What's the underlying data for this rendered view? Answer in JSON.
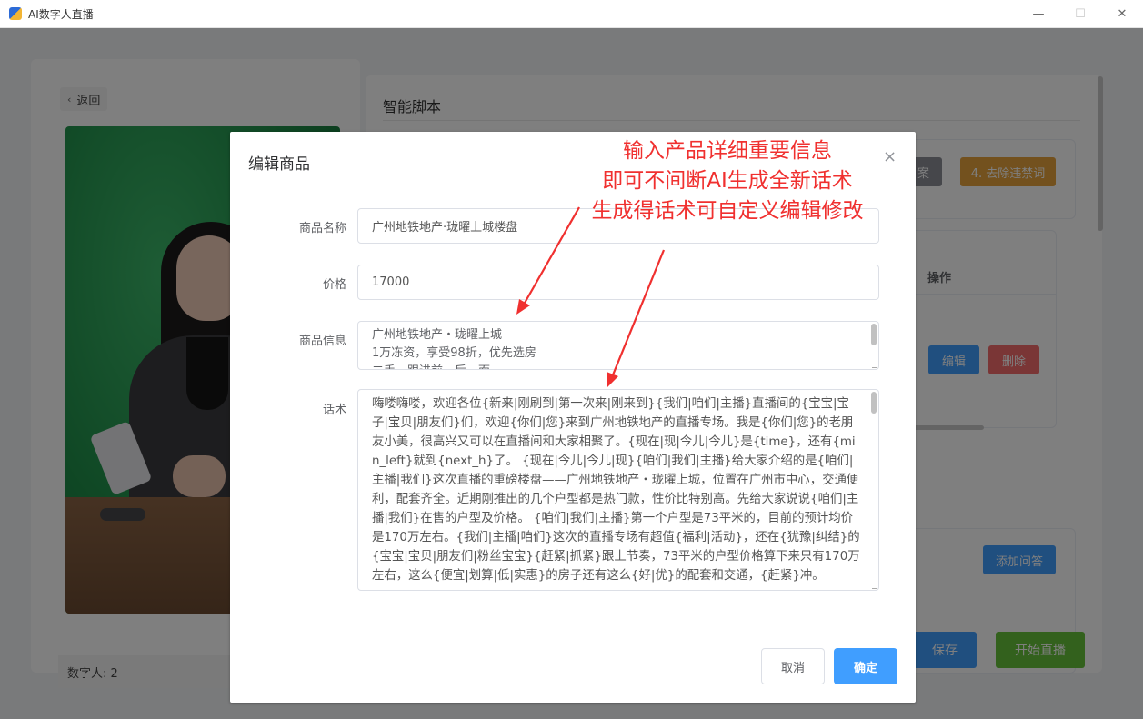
{
  "window": {
    "title": "AI数字人直播",
    "minimize_glyph": "—",
    "maximize_glyph": "☐",
    "close_glyph": "✕"
  },
  "left_panel": {
    "back_label": "返回",
    "digital_human_label": "数字人: 2"
  },
  "right_panel": {
    "title": "智能脚本",
    "buttons": {
      "partial_label": "案",
      "remove_banned_words": "4. 去除违禁词",
      "edit": "编辑",
      "delete": "删除",
      "add_qa": "添加问答",
      "save": "保存",
      "start_live": "开始直播"
    },
    "table_header_operation": "操作"
  },
  "dialog": {
    "title": "编辑商品",
    "close_glyph": "×",
    "fields": {
      "name_label": "商品名称",
      "name_value": "广州地铁地产·珑曜上城楼盘",
      "price_label": "价格",
      "price_value": "17000",
      "info_label": "商品信息",
      "info_lines": [
        "广州地铁地产・珑曜上城",
        "1万冻资，享受98折，优先选房",
        "二手…跟进前…后…面"
      ],
      "script_label": "话术",
      "script_value": "嗨喽嗨喽，欢迎各位{新来|刚刷到|第一次来|刚来到}{我们|咱们|主播}直播间的{宝宝|宝子|宝贝|朋友们}们，欢迎{你们|您}来到广州地铁地产的直播专场。我是{你们|您}的老朋友小美，很高兴又可以在直播间和大家相聚了。{现在|现|今儿|今儿}是{time}，还有{min_left}就到{next_h}了。 {现在|今儿|今儿|现}{咱们|我们|主播}给大家介绍的是{咱们|主播|我们}这次直播的重磅楼盘——广州地铁地产・珑曜上城，位置在广州市中心，交通便利，配套齐全。近期刚推出的几个户型都是热门款，性价比特别高。先给大家说说{咱们|主播|我们}在售的户型及价格。 {咱们|我们|主播}第一个户型是73平米的，目前的预计均价是170万左右。{我们|主播|咱们}这次的直播专场有超值{福利|活动}，还在{犹豫|纠结}的{宝宝|宝贝|朋友们|粉丝宝宝}{赶紧|抓紧}跟上节奏，73平米的户型价格算下来只有170万左右，这么{便宜|划算|低|实惠}的房子还有这么{好|优}的配套和交通，{赶紧}冲。"
    },
    "cancel_label": "取消",
    "ok_label": "确定"
  },
  "annotation": {
    "lines": [
      "输入产品详细重要信息",
      "即可不间断AI生成全新话术",
      "生成得话术可自定义编辑修改"
    ]
  },
  "colors": {
    "primary": "#409eff",
    "danger": "#f56c6c",
    "warning": "#e6a23c",
    "success": "#67c23a",
    "annotation": "#f0302f"
  }
}
